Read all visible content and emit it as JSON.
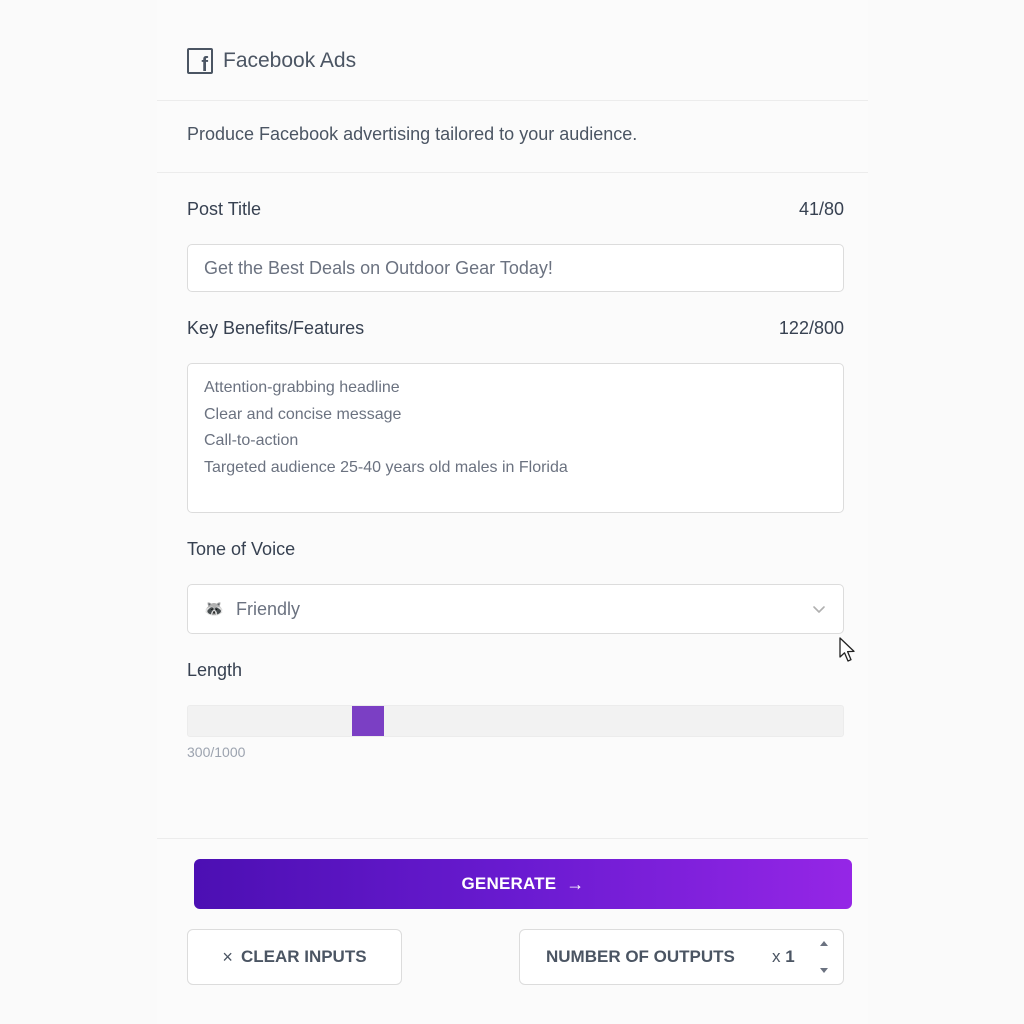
{
  "header": {
    "icon": "facebook-icon",
    "title": "Facebook Ads"
  },
  "description": "Produce Facebook advertising tailored to your audience.",
  "post_title": {
    "label": "Post Title",
    "counter": "41/80",
    "value": "Get the Best Deals on Outdoor Gear Today!"
  },
  "key_benefits": {
    "label": "Key Benefits/Features",
    "counter": "122/800",
    "value": "Attention-grabbing headline\nClear and concise message\nCall-to-action\nTargeted audience 25-40 years old males in Florida"
  },
  "tone": {
    "label": "Tone of Voice",
    "selected": "Friendly",
    "emoji": "🦝",
    "icon": "chevron-down-icon"
  },
  "length": {
    "label": "Length",
    "value_text": "300/1000",
    "value": 300,
    "max": 1000
  },
  "actions": {
    "generate_label": "GENERATE",
    "generate_arrow": "→",
    "clear_icon": "×",
    "clear_label": "CLEAR INPUTS",
    "outputs_label": "NUMBER OF OUTPUTS",
    "outputs_prefix": "x",
    "outputs_count": "1"
  },
  "colors": {
    "accent": "#7b3fc4",
    "generate_start": "#4c0fb3",
    "generate_end": "#9526e6"
  }
}
